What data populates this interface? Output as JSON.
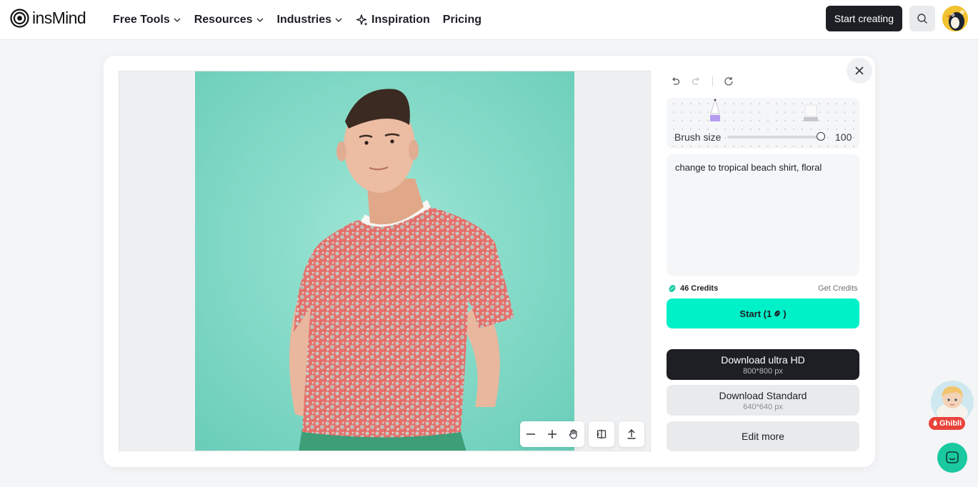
{
  "header": {
    "logo_text": "insMind",
    "nav": [
      {
        "label": "Free Tools",
        "dropdown": true
      },
      {
        "label": "Resources",
        "dropdown": true
      },
      {
        "label": "Industries",
        "dropdown": true
      },
      {
        "label": "Inspiration",
        "icon": "sparkle-icon"
      },
      {
        "label": "Pricing"
      }
    ],
    "start_creating_label": "Start creating",
    "search_icon": "search-icon"
  },
  "canvas": {
    "image_alt": "Model wearing red floral t-shirt on teal background",
    "toolbar_icons": [
      "zoom-out-icon",
      "zoom-in-icon",
      "hand-icon",
      "compare-icon",
      "upload-icon"
    ]
  },
  "panel": {
    "history_icons": [
      "undo-icon",
      "redo-icon",
      "reset-icon"
    ],
    "brush_label": "Brush size",
    "brush_value": "100",
    "brush_level": 1.0,
    "prompt_text": "change to tropical beach shirt, floral",
    "credits_label": "46 Credits",
    "get_credits_label": "Get Credits",
    "start_label": "Start (1",
    "start_suffix": ")",
    "download_hd_label": "Download ultra HD",
    "download_hd_size": "800*800 px",
    "download_std_label": "Download Standard",
    "download_std_size": "640*640 px",
    "edit_more_label": "Edit more"
  },
  "floating": {
    "ghibli_label": "Ghibli"
  },
  "colors": {
    "accent": "#00f0c8",
    "dark": "#1d1f24",
    "chat": "#1ac9a0"
  }
}
